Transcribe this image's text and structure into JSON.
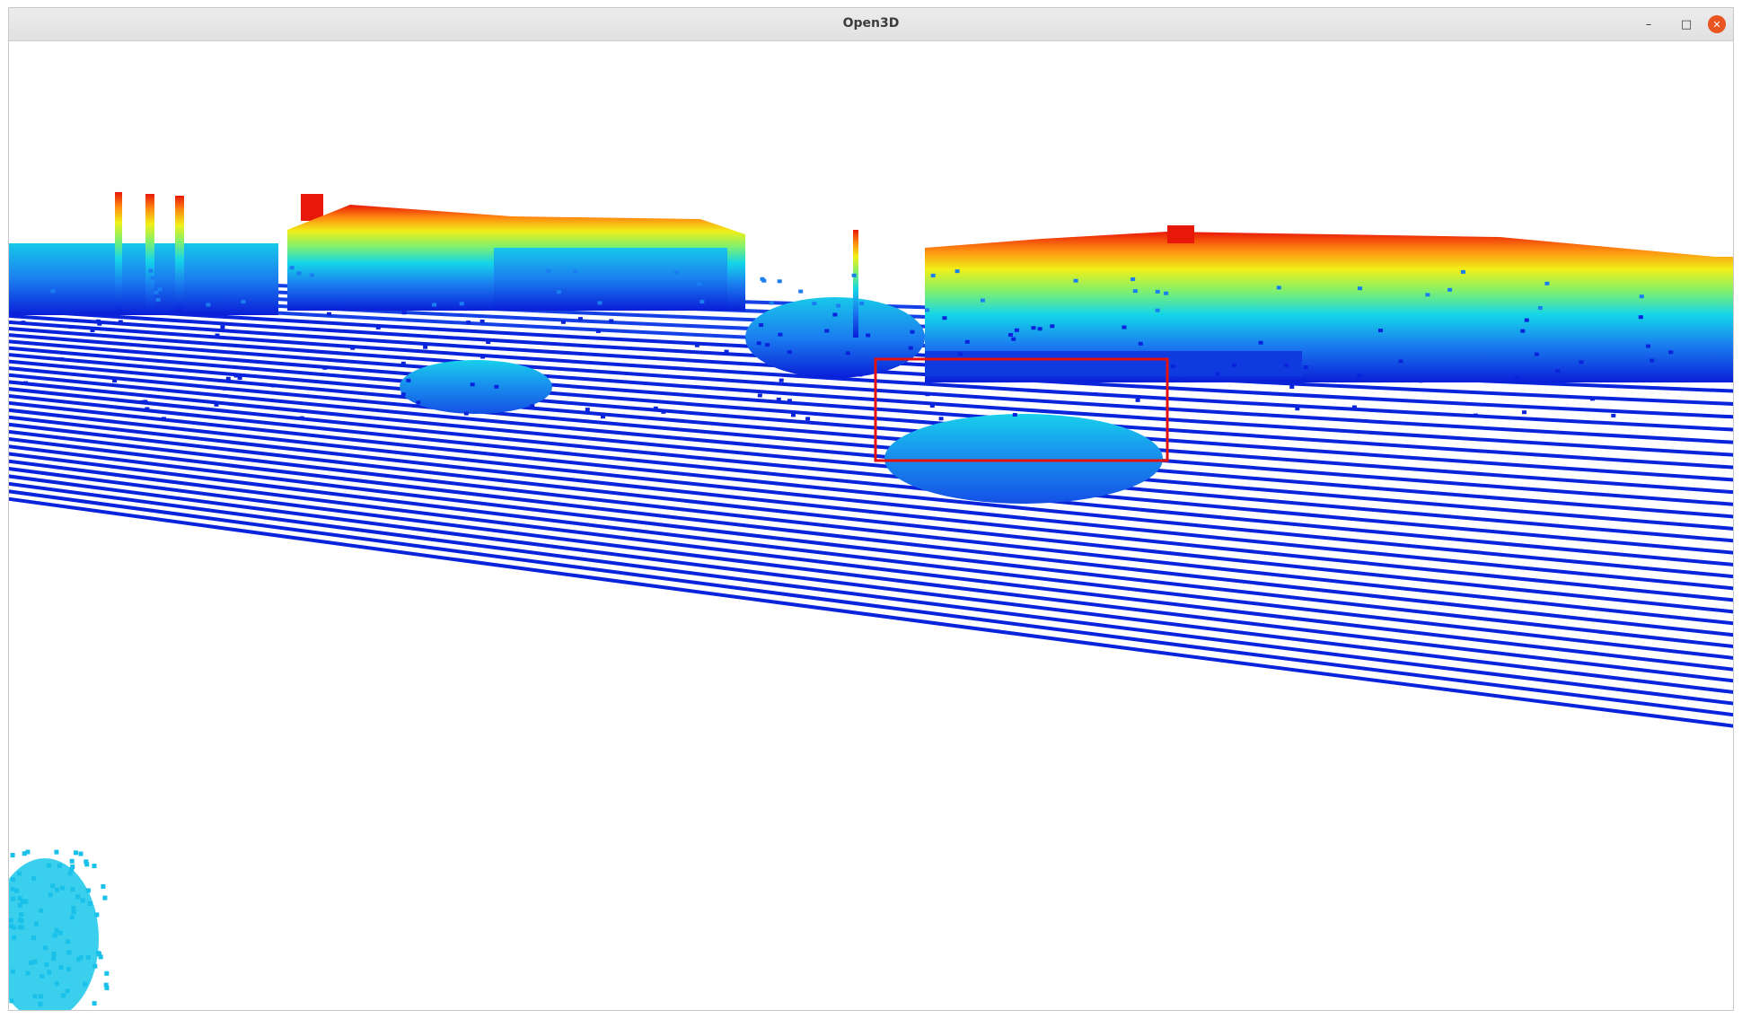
{
  "window": {
    "title": "Open3D",
    "minimize_glyph": "–",
    "maximize_glyph": "□",
    "close_glyph": "✕",
    "close_color": "#e95420"
  },
  "scene": {
    "background": "#ffffff",
    "highlight_box_color": "#e41010",
    "colormap": "jet"
  }
}
